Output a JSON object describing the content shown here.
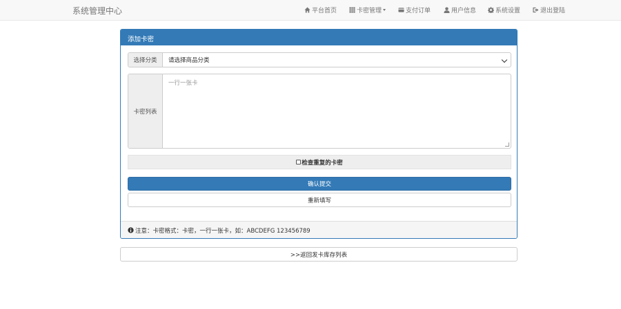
{
  "navbar": {
    "brand": "系统管理中心",
    "items": [
      {
        "label": "平台首页",
        "icon": "home-icon"
      },
      {
        "label": "卡密管理",
        "icon": "grid-icon",
        "dropdown": true
      },
      {
        "label": "支付订单",
        "icon": "card-icon"
      },
      {
        "label": "用户信息",
        "icon": "user-icon"
      },
      {
        "label": "系统设置",
        "icon": "gear-icon"
      },
      {
        "label": "退出登陆",
        "icon": "logout-icon"
      }
    ]
  },
  "panel": {
    "title": "添加卡密",
    "category_label": "选择分类",
    "category_value": "请选择商品分类",
    "list_label": "卡密列表",
    "list_placeholder": "一行一张卡",
    "check_label": "检查重复的卡密",
    "submit_label": "确认提交",
    "reset_label": "重新填写",
    "note": "注意：卡密格式：卡密，一行一张卡，如：ABCDEFG 123456789"
  },
  "back_link": ">>返回发卡库存列表",
  "colors": {
    "primary": "#337ab7",
    "navbar_bg": "#f8f8f8"
  }
}
